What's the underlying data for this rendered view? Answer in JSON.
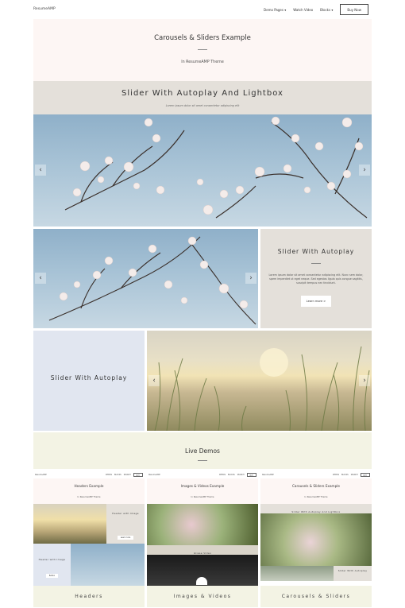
{
  "nav": {
    "brand": "ResumeAMP",
    "links": [
      "Demo Pages ▾",
      "Watch Video",
      "Blocks ▾"
    ],
    "buy": "Buy Now"
  },
  "hero": {
    "title": "Carousels & Sliders Example",
    "subtitle": "In ResumeAMP Theme"
  },
  "slider1": {
    "title": "Slider With Autoplay And Lightbox",
    "subtitle": "Lorem ipsum dolor sit amet consectetur adipiscing elit"
  },
  "slider2": {
    "title": "Slider With Autoplay",
    "text": "Lorem ipsum dolor sit amet consectetur adipiscing elit. Nunc sem dolor, spem imperdiet ut eget neque. Sed egestas ligula quis congue sagittis, suscipit tempus nec tincidunt.",
    "button": "Learn more >"
  },
  "slider3": {
    "title": "Slider With Autoplay"
  },
  "live": {
    "title": "Live Demos"
  },
  "demos": [
    {
      "brand": "ResumeAMP",
      "links": [
        "DEMOS",
        "BLOCKS",
        "SEARCH"
      ],
      "buy": "BUY",
      "title": "Headers Example",
      "subtitle": "In ResumeAMP Theme",
      "panel_label": "Header with Image",
      "panel_btn": "Learn more",
      "lower_label": "Header with Image",
      "lower_btn": "Button",
      "label": "Headers"
    },
    {
      "brand": "ResumeAMP",
      "links": [
        "DEMOS",
        "BLOCKS",
        "SEARCH"
      ],
      "buy": "BUY",
      "title": "Images & Videos Example",
      "subtitle": "In ResumeAMP Theme",
      "panel_label": "Gliese Video",
      "label": "Images & Videos"
    },
    {
      "brand": "ResumeAMP",
      "links": [
        "DEMOS",
        "BLOCKS",
        "SEARCH"
      ],
      "buy": "BUY",
      "title": "Carousels & Sliders Example",
      "subtitle": "In ResumeAMP Theme",
      "panel_label": "Slider With Autoplay And Lightbox",
      "lower_label": "Slider With Autoplay",
      "label": "Carousels & Sliders"
    }
  ]
}
